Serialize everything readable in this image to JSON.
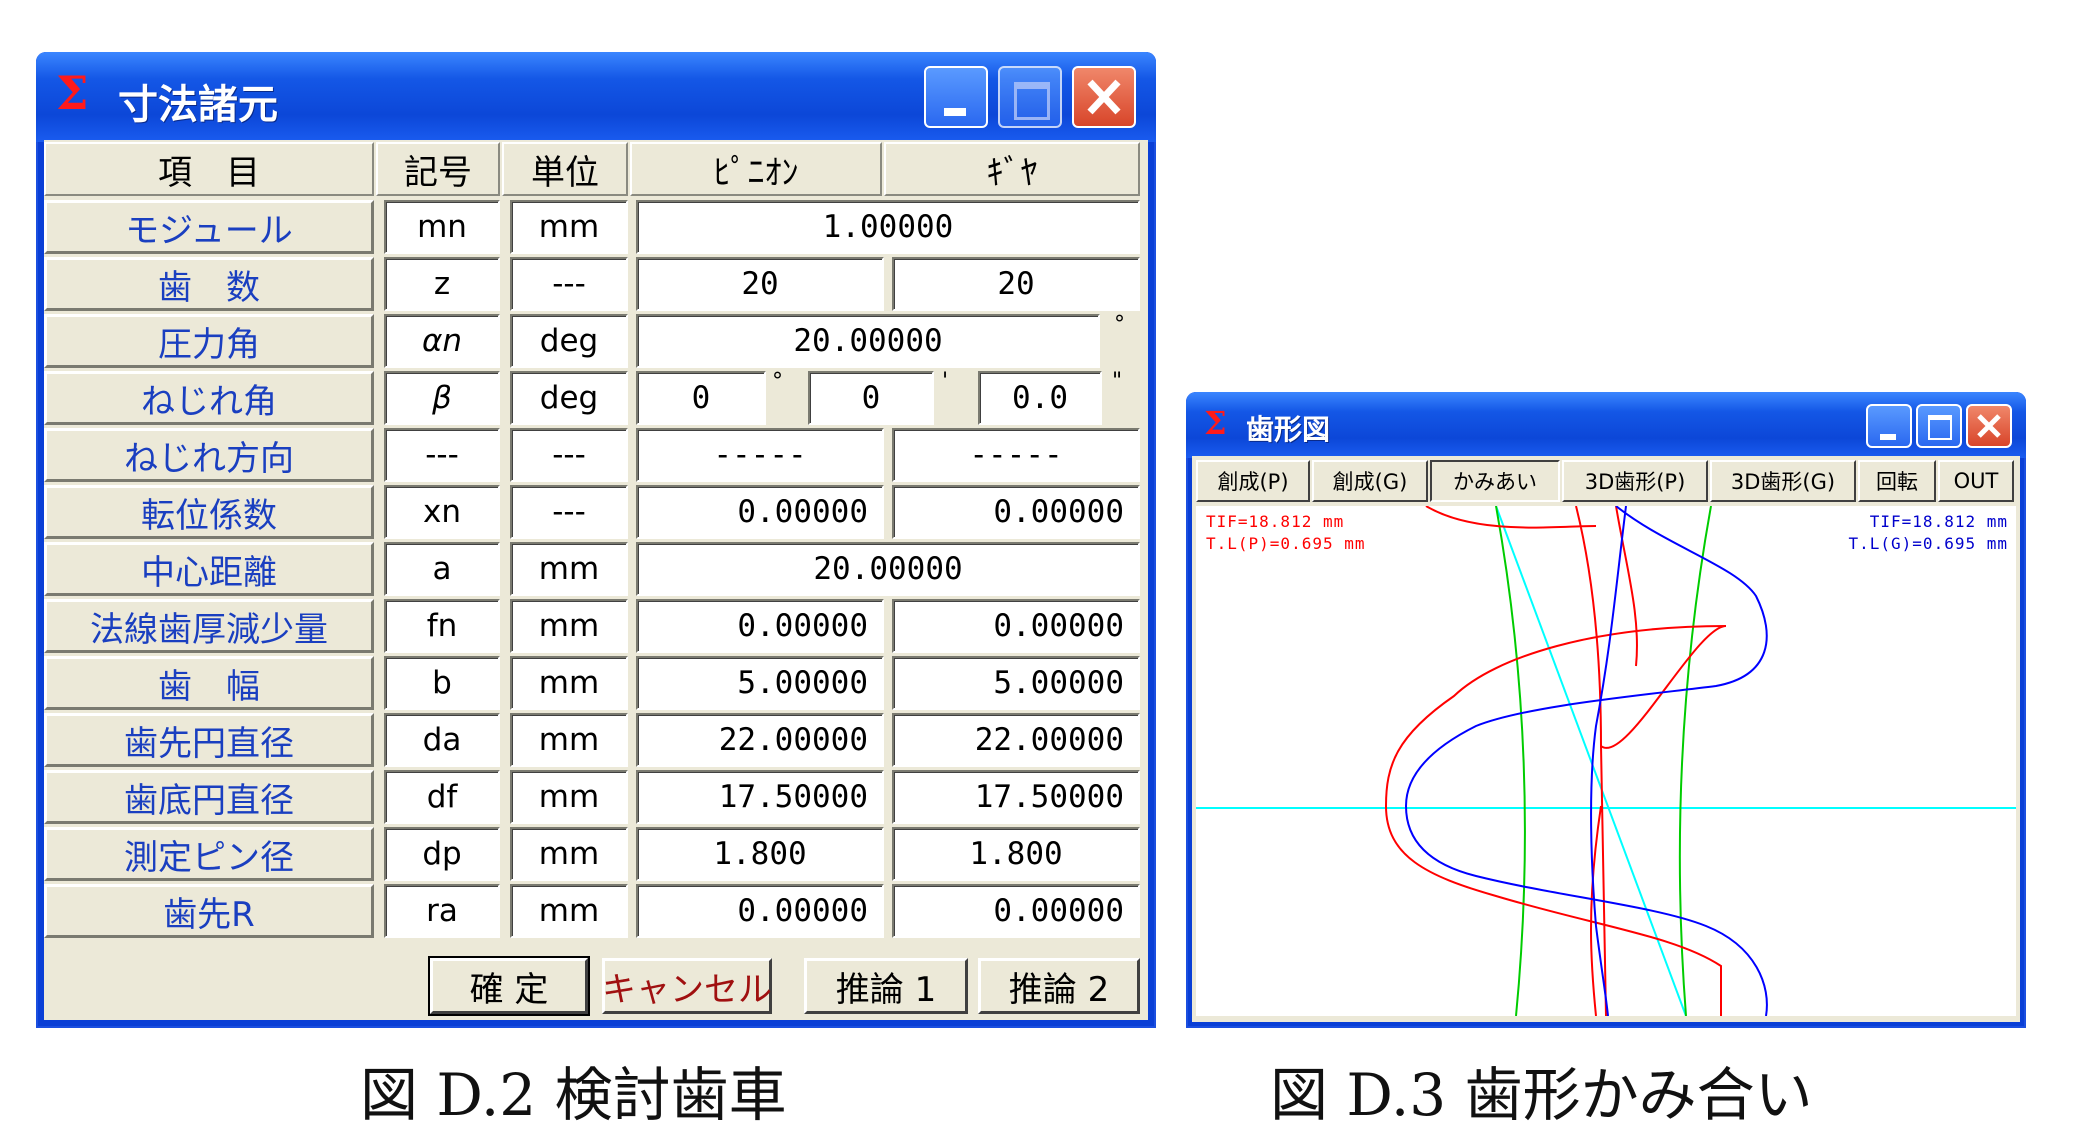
{
  "dialog": {
    "title": "寸法諸元",
    "sigma": "Σ",
    "headers": [
      "項　目",
      "記号",
      "単位",
      "ﾋﾟﾆｵﾝ",
      "ｷﾞﾔ"
    ],
    "rows": [
      {
        "label": "モジュール",
        "symbol": "mn",
        "unit": "mm",
        "shared": "1.00000"
      },
      {
        "label": "歯　数",
        "symbol": "z",
        "unit": "---",
        "pinion": "20",
        "gear": "20"
      },
      {
        "label": "圧力角",
        "symbol": "αn",
        "unit": "deg",
        "shared": "20.00000"
      },
      {
        "label": "ねじれ角",
        "symbol": "β",
        "unit": "deg",
        "deg": "0",
        "min": "0",
        "sec": "0.0"
      },
      {
        "label": "ねじれ方向",
        "symbol": "---",
        "unit": "---",
        "pinion": "-----",
        "gear": "-----"
      },
      {
        "label": "転位係数",
        "symbol": "xn",
        "unit": "---",
        "pinion": "0.00000",
        "gear": "0.00000"
      },
      {
        "label": "中心距離",
        "symbol": "a",
        "unit": "mm",
        "shared": "20.00000"
      },
      {
        "label": "法線歯厚減少量",
        "symbol": "fn",
        "unit": "mm",
        "pinion": "0.00000",
        "gear": "0.00000"
      },
      {
        "label": "歯　幅",
        "symbol": "b",
        "unit": "mm",
        "pinion": "5.00000",
        "gear": "5.00000"
      },
      {
        "label": "歯先円直径",
        "symbol": "da",
        "unit": "mm",
        "pinion": "22.00000",
        "gear": "22.00000"
      },
      {
        "label": "歯底円直径",
        "symbol": "df",
        "unit": "mm",
        "pinion": "17.50000",
        "gear": "17.50000"
      },
      {
        "label": "測定ピン径",
        "symbol": "dp",
        "unit": "mm",
        "pinion": "1.800",
        "gear": "1.800"
      },
      {
        "label": "歯先R",
        "symbol": "ra",
        "unit": "mm",
        "pinion": "0.00000",
        "gear": "0.00000"
      }
    ],
    "marks": {
      "degree": "°",
      "minute": "'",
      "second": "\""
    },
    "buttons": {
      "ok": "確 定",
      "cancel": "キャンセル",
      "infer1": "推論 1",
      "infer2": "推論 2"
    }
  },
  "profile_window": {
    "title": "歯形図",
    "sigma": "Σ",
    "tabs": [
      "創成(P)",
      "創成(G)",
      "かみあい",
      "3D歯形(P)",
      "3D歯形(G)",
      "回転",
      "OUT"
    ],
    "active_tab": "かみあい",
    "left_info": [
      "TIF=18.812 mm",
      "T.L(P)=0.695 mm"
    ],
    "right_info": [
      "TIF=18.812 mm",
      "T.L(G)=0.695 mm"
    ],
    "colors": {
      "pinion": "#ff0000",
      "gear": "#0000ff",
      "line_of_action": "#00ffff",
      "circles": "#00cc00"
    }
  },
  "captions": {
    "left": "図 D.2  検討歯車",
    "right": "図 D.3  歯形かみ合い"
  }
}
